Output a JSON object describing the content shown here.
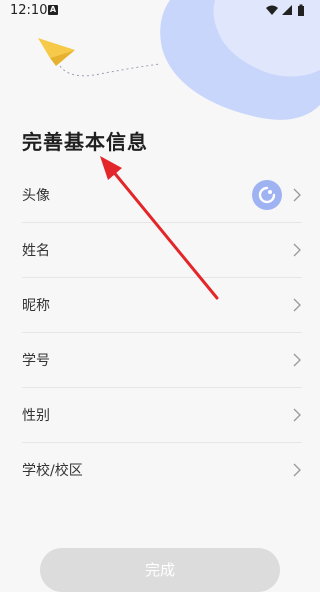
{
  "status_bar": {
    "time": "12:10",
    "notification_icon": "a-badge-icon",
    "icons": [
      "wifi-icon",
      "signal-icon",
      "battery-icon"
    ]
  },
  "page": {
    "title": "完善基本信息"
  },
  "form": {
    "rows": [
      {
        "label": "头像",
        "has_avatar": true
      },
      {
        "label": "姓名"
      },
      {
        "label": "昵称"
      },
      {
        "label": "学号"
      },
      {
        "label": "性别"
      },
      {
        "label": "学校/校区"
      }
    ]
  },
  "finish_button": {
    "label": "完成"
  },
  "colors": {
    "blob_blue": "#c9d6fb",
    "blob_light": "#e4eafc",
    "avatar_bg": "#9fb3f3",
    "annotation_red": "#e3262a",
    "plane_yellow": "#f7c948",
    "button_disabled": "#dcdcdc"
  }
}
